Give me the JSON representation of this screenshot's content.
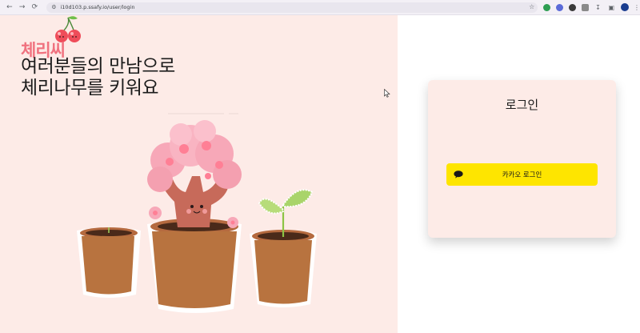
{
  "browser": {
    "url": "i10d103.p.ssafy.io/user/login",
    "back_icon": "arrow-left-icon",
    "forward_icon": "arrow-right-icon",
    "reload_icon": "reload-icon"
  },
  "hero": {
    "brand": "체리씨",
    "headline_line1": "여러분들의 만남으로",
    "headline_line2": "체리나무를 키워요"
  },
  "login": {
    "title": "로그인",
    "kakao_label": "카카오 로그인",
    "kakao_color": "#fee500"
  },
  "colors": {
    "left_bg": "#fdebe7",
    "brand": "#f0727f"
  }
}
